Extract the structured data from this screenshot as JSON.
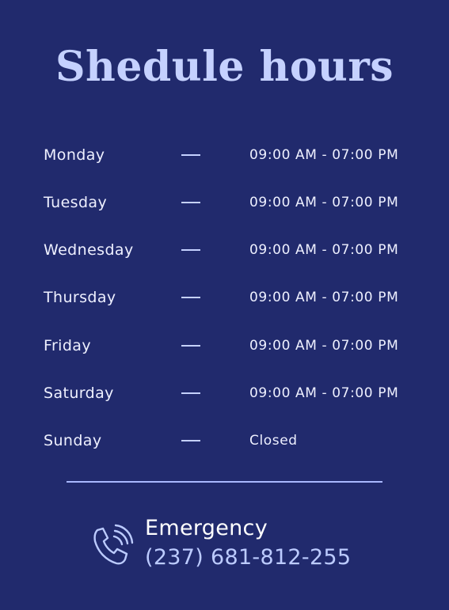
{
  "title": "Shedule hours",
  "schedule": [
    {
      "day": "Monday",
      "hours": "09:00 AM - 07:00 PM"
    },
    {
      "day": "Tuesday",
      "hours": "09:00 AM - 07:00 PM"
    },
    {
      "day": "Wednesday",
      "hours": "09:00 AM - 07:00 PM"
    },
    {
      "day": "Thursday",
      "hours": "09:00 AM - 07:00 PM"
    },
    {
      "day": "Friday",
      "hours": "09:00 AM - 07:00 PM"
    },
    {
      "day": "Saturday",
      "hours": "09:00 AM - 07:00 PM"
    },
    {
      "day": "Sunday",
      "hours": "Closed"
    }
  ],
  "emergency": {
    "label": "Emergency",
    "phone": "(237) 681-812-255",
    "icon": "phone-call-icon"
  },
  "colors": {
    "background": "#212a6d",
    "title": "#c5d1ff",
    "text": "#eef0ff",
    "accent": "#bccbff"
  }
}
